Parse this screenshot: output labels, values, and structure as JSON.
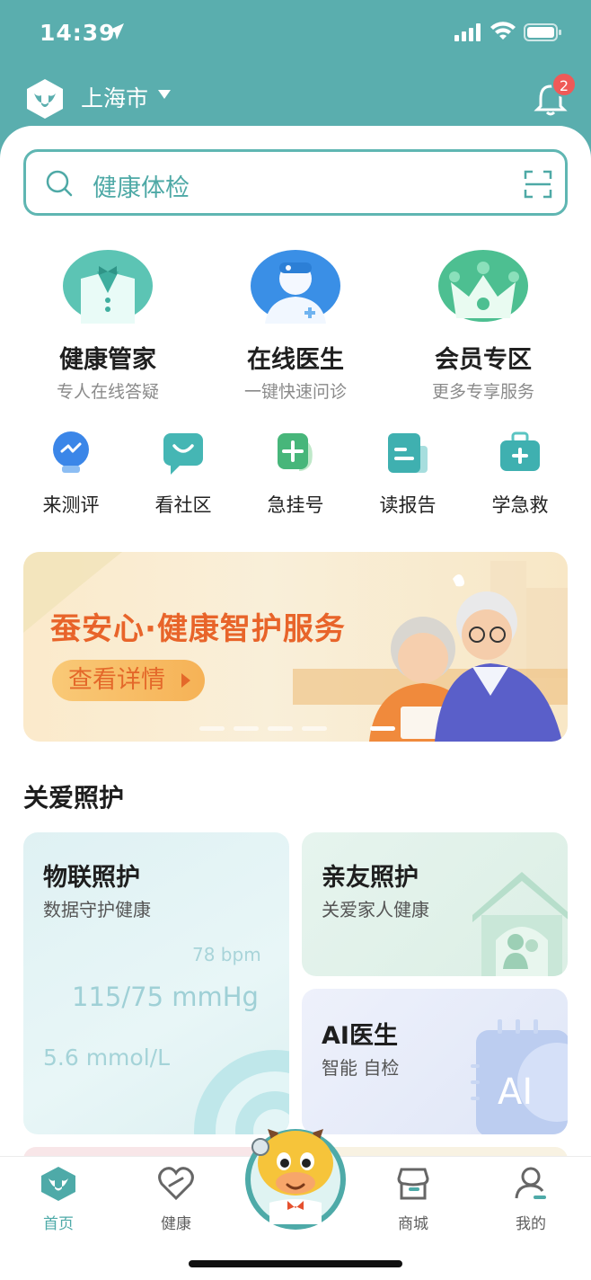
{
  "status_bar": {
    "time": "14:39"
  },
  "header": {
    "city": "上海市",
    "notification_count": "2"
  },
  "search": {
    "placeholder": "健康体检"
  },
  "features": [
    {
      "title": "健康管家",
      "subtitle": "专人在线答疑",
      "icon": "butler-icon"
    },
    {
      "title": "在线医生",
      "subtitle": "一键快速问诊",
      "icon": "doctor-icon"
    },
    {
      "title": "会员专区",
      "subtitle": "更多专享服务",
      "icon": "crown-icon"
    }
  ],
  "quick_actions": [
    {
      "label": "来测评",
      "icon": "bulb-icon"
    },
    {
      "label": "看社区",
      "icon": "chat-icon"
    },
    {
      "label": "急挂号",
      "icon": "register-icon"
    },
    {
      "label": "读报告",
      "icon": "report-icon"
    },
    {
      "label": "学急救",
      "icon": "first-aid-icon"
    }
  ],
  "banner": {
    "title": "蚕安心·健康智护服务",
    "button": "查看详情",
    "slides": 5,
    "active_slide": 4
  },
  "section": {
    "title": "关爱照护"
  },
  "cards": {
    "iot": {
      "title": "物联照护",
      "subtitle": "数据守护健康",
      "heart_rate": "78 bpm",
      "blood_pressure": "115/75 mmHg",
      "glucose": "5.6 mmol/L"
    },
    "family": {
      "title": "亲友照护",
      "subtitle": "关爱家人健康"
    },
    "ai": {
      "title": "AI医生",
      "subtitle": "智能 自检",
      "art_text": "AI"
    }
  },
  "tabbar": {
    "items": [
      {
        "label": "首页",
        "active": true
      },
      {
        "label": "健康",
        "active": false
      },
      {
        "label": "商城",
        "active": false
      },
      {
        "label": "我的",
        "active": false
      }
    ]
  },
  "colors": {
    "primary": "#5aaeae",
    "accent": "#4eaaa8",
    "banner_title": "#e8642a",
    "badge": "#ef5a58"
  }
}
